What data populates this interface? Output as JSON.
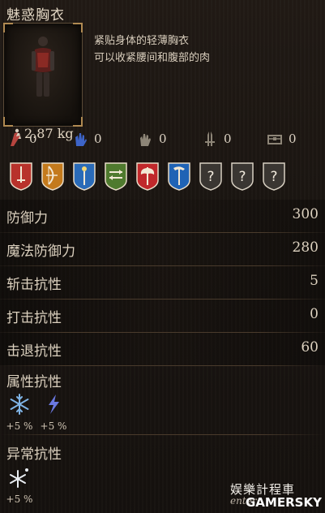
{
  "item": {
    "name": "魅惑胸衣",
    "weight": "2.87 kg",
    "description": [
      "紧贴身体的轻薄胸衣",
      "可以收紧腰间和腹部的肉"
    ]
  },
  "resists": [
    {
      "icon": "slash-resist-icon",
      "color": "#b8453f",
      "value": "0"
    },
    {
      "icon": "magic-resist-icon",
      "color": "#3d64c8",
      "value": "0"
    },
    {
      "icon": "fist-resist-icon",
      "color": "#8d8577",
      "value": "0"
    },
    {
      "icon": "dagger-resist-icon",
      "color": "#8d8577",
      "value": "0"
    },
    {
      "icon": "chest-icon",
      "color": "#8d8577",
      "value": "0"
    }
  ],
  "shields": [
    {
      "icon": "sword-shield-icon",
      "color": "#b8322b"
    },
    {
      "icon": "bow-shield-icon",
      "color": "#c47a1c"
    },
    {
      "icon": "staff-shield-icon",
      "color": "#2a6bb8"
    },
    {
      "icon": "dual-weapon-shield-icon",
      "color": "#4f7a2e"
    },
    {
      "icon": "axe-shield-icon",
      "color": "#c0282b"
    },
    {
      "icon": "hammer-shield-icon",
      "color": "#1f63b5"
    },
    {
      "icon": "unknown-shield-icon",
      "label": "?"
    },
    {
      "icon": "unknown-shield-icon",
      "label": "?"
    },
    {
      "icon": "unknown-shield-icon",
      "label": "?"
    }
  ],
  "stats": [
    {
      "label": "防御力",
      "value": "300"
    },
    {
      "label": "魔法防御力",
      "value": "280"
    },
    {
      "label": "斩击抗性",
      "value": "5"
    },
    {
      "label": "打击抗性",
      "value": "0"
    },
    {
      "label": "击退抗性",
      "value": "60"
    }
  ],
  "attribute_resist": {
    "title": "属性抗性",
    "items": [
      {
        "icon": "frost-icon",
        "value": "+5 %"
      },
      {
        "icon": "lightning-icon",
        "value": "+5 %"
      }
    ]
  },
  "status_resist": {
    "title": "异常抗性",
    "items": [
      {
        "icon": "frostbite-icon",
        "value": "+5 %"
      }
    ]
  },
  "watermark": {
    "cn": "娱樂計程車",
    "en": "enter",
    "brand": "GAMERSKY"
  }
}
